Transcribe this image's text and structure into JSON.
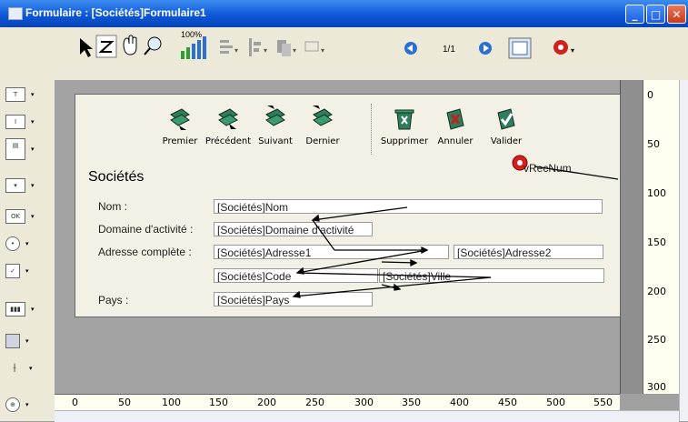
{
  "window": {
    "title": "Formulaire : [Sociétés]Formulaire1"
  },
  "toolbar": {
    "zoom_label": "100%",
    "page_indicator": "1/1"
  },
  "buttons": [
    {
      "label": "Premier"
    },
    {
      "label": "Précédent"
    },
    {
      "label": "Suivant"
    },
    {
      "label": "Dernier"
    },
    {
      "label": "Supprimer"
    },
    {
      "label": "Annuler"
    },
    {
      "label": "Valider"
    }
  ],
  "form": {
    "title": "Sociétés",
    "labels": {
      "nom": "Nom :",
      "domaine": "Domaine d'activité :",
      "adresse": "Adresse complète :",
      "pays": "Pays :"
    },
    "fields": {
      "nom": "[Sociétés]Nom",
      "domaine": "[Sociétés]Domaine d'activité",
      "adresse1": "[Sociétés]Adresse1",
      "adresse2": "[Sociétés]Adresse2",
      "code": "[Sociétés]Code",
      "ville": "[Sociétés]Ville",
      "pays": "[Sociétés]Pays"
    },
    "vrecnum": "vRecNum"
  },
  "ruler_v": [
    "0",
    "50",
    "100",
    "150",
    "200",
    "250",
    "300"
  ],
  "ruler_h": [
    "0",
    "50",
    "100",
    "150",
    "200",
    "250",
    "300",
    "350",
    "400",
    "450",
    "500",
    "550"
  ],
  "colors": {
    "title_bar": "#0a54d6",
    "form_bg": "#f3f1e6",
    "canvas_bg": "#a3a3a3",
    "button_icon": "#2f7d5d"
  }
}
